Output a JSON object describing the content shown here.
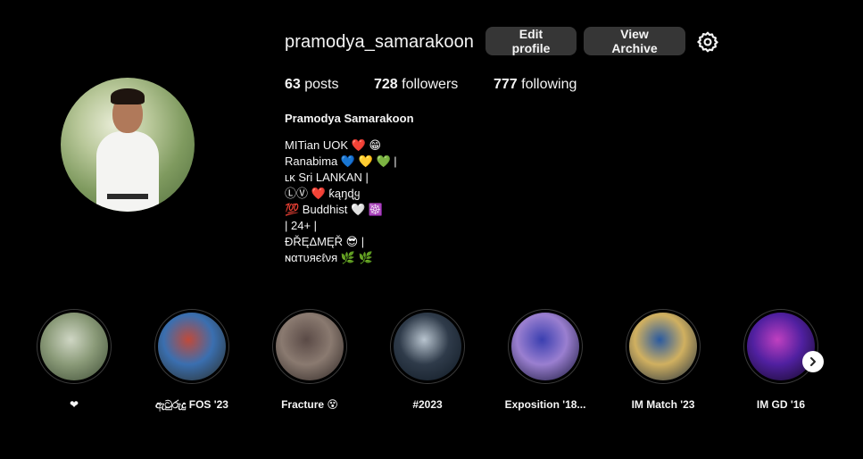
{
  "profile": {
    "username": "pramodya_samarakoon",
    "full_name": "Pramodya Samarakoon",
    "edit_label": "Edit profile",
    "archive_label": "View Archive",
    "settings_icon": "gear-icon"
  },
  "stats": {
    "posts_count": "63",
    "posts_label": " posts",
    "followers_count": "728",
    "followers_label": " followers",
    "following_count": "777",
    "following_label": " following"
  },
  "bio": {
    "lines": [
      "MITian UOK ❤️ 😁",
      "Ranabima 💙 💛 💚 |",
      "ʟᴋ Sri LANKAN |",
      "ⓁⓋ ❤️ ƙąŋɖყ",
      "💯 Buddhist 🤍 ☸️",
      "| 24+ |",
      "ĐŘĘΔΜĘŘ 😎 |",
      "ɴαтυяєℓνя 🌿 🌿"
    ]
  },
  "highlights": [
    {
      "label": "❤",
      "colors": [
        "#cfd6c4",
        "#8a9a78",
        "#3b4a33"
      ]
    },
    {
      "label": "ඇටුරුදු FOS '23",
      "colors": [
        "#c04a3a",
        "#3a6fb0",
        "#2b2a20"
      ]
    },
    {
      "label": "Fracture 😵",
      "colors": [
        "#5a4a46",
        "#8a7a70",
        "#2a2220"
      ]
    },
    {
      "label": "#2023",
      "colors": [
        "#b8c4cf",
        "#2f3b4a",
        "#0e1822"
      ]
    },
    {
      "label": "Exposition '18...",
      "colors": [
        "#3a3fb0",
        "#9a7fd0",
        "#101030"
      ]
    },
    {
      "label": "IM Match '23",
      "colors": [
        "#2a5aa0",
        "#d0b060",
        "#1a2a40"
      ]
    },
    {
      "label": "IM GD '16",
      "colors": [
        "#c040c0",
        "#5020a0",
        "#10081a"
      ]
    }
  ],
  "next_icon": "chevron-right-icon"
}
